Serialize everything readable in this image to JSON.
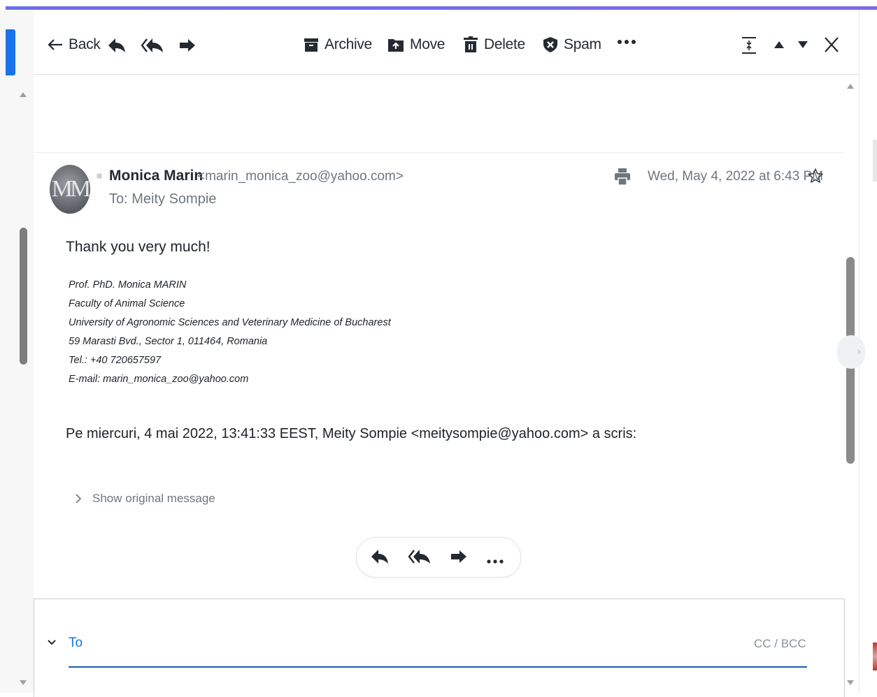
{
  "accent_color": "#1a73e8",
  "toolbar": {
    "back_label": "Back",
    "archive_label": "Archive",
    "move_label": "Move",
    "delete_label": "Delete",
    "spam_label": "Spam",
    "close_label": "X"
  },
  "message": {
    "sender_name": "Monica Marin",
    "sender_email": "<marin_monica_zoo@yahoo.com>",
    "to_line": "To: Meity Sompie",
    "date": "Wed, May 4, 2022 at 6:43 PM",
    "avatar_initials": "MM",
    "greeting": "Thank you very much!",
    "signature": [
      "Prof. PhD. Monica MARIN",
      "Faculty of Animal Science",
      "University of Agronomic Sciences and Veterinary Medicine of Bucharest",
      "59 Marasti Bvd., Sector 1, 011464, Romania",
      "Tel.: +40 720657597",
      "E-mail: marin_monica_zoo@yahoo.com"
    ],
    "quote_header": "Pe miercuri, 4 mai 2022, 13:41:33 EEST, Meity Sompie <meitysompie@yahoo.com> a scris:",
    "show_original": "Show original message"
  },
  "compose": {
    "to_label": "To",
    "cc_bcc_label": "CC / BCC"
  }
}
